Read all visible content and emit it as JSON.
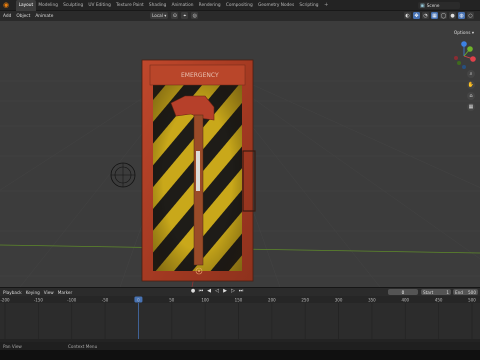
{
  "topbar": {
    "menu": [
      "File",
      "Edit",
      "Render",
      "Window",
      "Help"
    ],
    "tabs": [
      "Layout",
      "Modeling",
      "Sculpting",
      "UV Editing",
      "Texture Paint",
      "Shading",
      "Animation",
      "Rendering",
      "Compositing",
      "Geometry Nodes",
      "Scripting"
    ],
    "active_tab": "Layout",
    "add_tab": "+",
    "scene_label": "Scene"
  },
  "viewport_header": {
    "left": [
      "Add",
      "Object",
      "Animate"
    ],
    "transform": "Local",
    "options_label": "Options"
  },
  "gizmo": {
    "axes": [
      "X",
      "Y",
      "Z"
    ],
    "colors": {
      "x": "#e0414a",
      "y": "#6fb32a",
      "z": "#3c81e3"
    }
  },
  "object": {
    "sign_text": "EMERGENCY",
    "frame_color": "#b23a22",
    "stripe_yellow": "#c9a81a",
    "stripe_black": "#1e1c18"
  },
  "timeline": {
    "header": [
      "Playback",
      "Keying",
      "View",
      "Marker"
    ],
    "current_frame": "0",
    "start_label": "Start",
    "start_value": "1",
    "end_label": "End",
    "end_value": "500",
    "ruler_ticks": [
      "-200",
      "-150",
      "-100",
      "-50",
      "0",
      "50",
      "100",
      "150",
      "200",
      "250",
      "300",
      "350",
      "400",
      "450",
      "500"
    ]
  },
  "statusbar": {
    "left": "Pan View",
    "right": "Context Menu"
  }
}
